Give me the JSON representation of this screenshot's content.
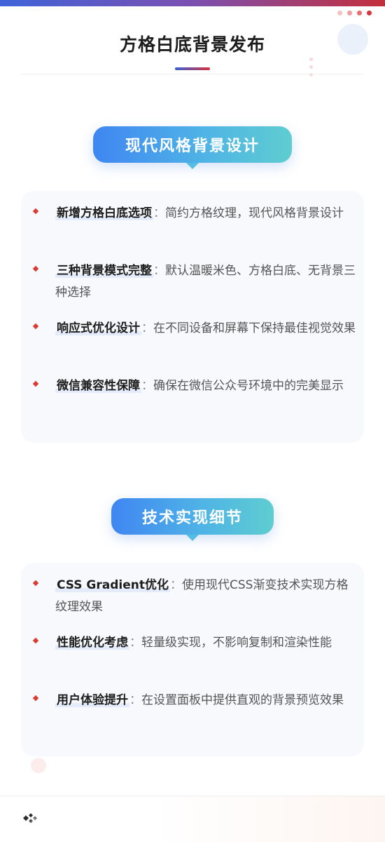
{
  "header": {
    "title": "方格白底背景发布",
    "accent_colors": [
      "#3e64d9",
      "#c4303b"
    ],
    "dot_colors": [
      "#f4c2c4",
      "#ef9ea2",
      "#e76b70",
      "#d9333d"
    ]
  },
  "sections": [
    {
      "heading": "现代风格背景设计",
      "items": [
        {
          "title": "新增方格白底选项",
          "sep": "：",
          "text": "简约方格纹理，现代风格背景设计"
        },
        {
          "title": "三种背景模式完整",
          "sep": "：",
          "text": "默认温暖米色、方格白底、无背景三种选择"
        },
        {
          "title": "响应式优化设计",
          "sep": "：",
          "text": "在不同设备和屏幕下保持最佳视觉效果"
        },
        {
          "title": "微信兼容性保障",
          "sep": "：",
          "text": "确保在微信公众号环境中的完美显示"
        }
      ]
    },
    {
      "heading": "技术实现细节",
      "items": [
        {
          "title": "CSS Gradient优化",
          "sep": "：",
          "text": "使用现代CSS渐变技术实现方格纹理效果"
        },
        {
          "title": "性能优化考虑",
          "sep": "：",
          "text": "轻量级实现，不影响复制和渲染性能"
        },
        {
          "title": "用户体验提升",
          "sep": "：",
          "text": "在设置面板中提供直观的背景预览效果"
        }
      ]
    }
  ],
  "footer": {
    "logo_icon": "brand-logo-icon"
  },
  "colors": {
    "pill_gradient": [
      "#3f86f2",
      "#5ecdd0"
    ],
    "bullet": "#db3b30",
    "card_bg": "#f8f9fc",
    "highlight": "#e4ecfb"
  }
}
